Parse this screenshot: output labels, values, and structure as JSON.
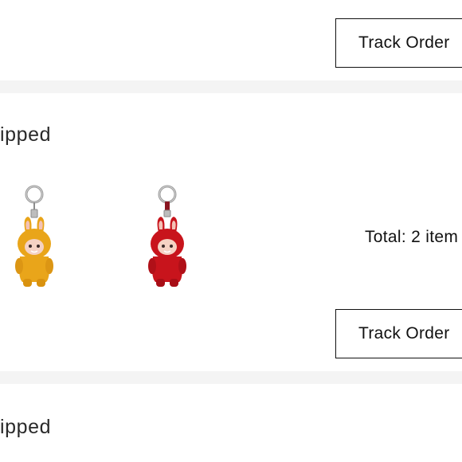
{
  "orders": [
    {
      "track_label": "Track Order"
    },
    {
      "status": "ipped",
      "items": [
        {
          "image": "yellow-bunny-keychain-plush",
          "color": "#e9a51a"
        },
        {
          "image": "red-bunny-keychain-plush",
          "color": "#c8141c"
        }
      ],
      "total_label": "Total: 2 item",
      "track_label": "Track Order"
    },
    {
      "status": "ipped"
    }
  ],
  "colors": {
    "separator": "#f4f4f4",
    "button_border": "#111111",
    "text": "#111111"
  }
}
